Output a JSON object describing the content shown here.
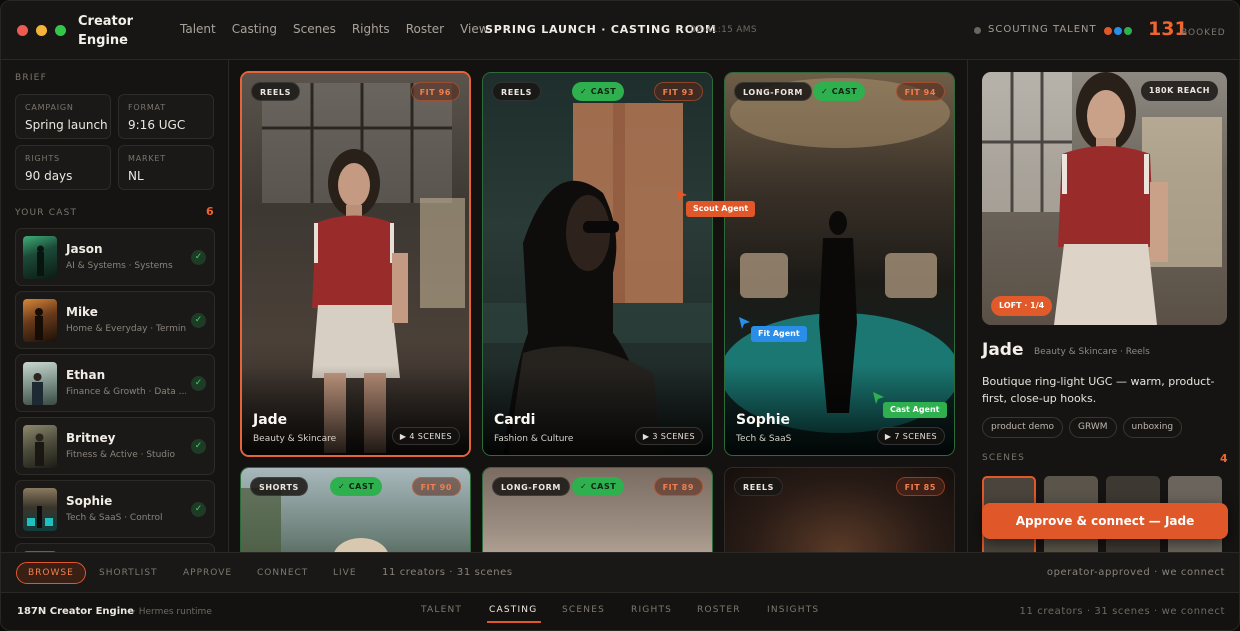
{
  "app": {
    "brand": "Creator Engine"
  },
  "nav": {
    "items": [
      "Talent",
      "Casting",
      "Scenes",
      "Rights",
      "Roster",
      "View"
    ]
  },
  "header": {
    "view_title": "SPRING LAUNCH · CASTING ROOM",
    "clock": "· 02:41:15 AMS",
    "status": "SCOUTING TALENT",
    "booked_count": "131",
    "booked_label": "BOOKED"
  },
  "brief": {
    "label": "BRIEF",
    "fields": [
      {
        "key": "CAMPAIGN",
        "value": "Spring launch"
      },
      {
        "key": "FORMAT",
        "value": "9:16 UGC"
      },
      {
        "key": "RIGHTS",
        "value": "90 days"
      },
      {
        "key": "MARKET",
        "value": "NL"
      }
    ]
  },
  "cast": {
    "label": "YOUR CAST",
    "count": "6",
    "items": [
      {
        "name": "Jason",
        "sub": "AI & Systems · Systems"
      },
      {
        "name": "Mike",
        "sub": "Home & Everyday · Terminal"
      },
      {
        "name": "Ethan",
        "sub": "Finance & Growth · Data ..."
      },
      {
        "name": "Britney",
        "sub": "Fitness & Active · Studio"
      },
      {
        "name": "Sophie",
        "sub": "Tech & SaaS · Control"
      }
    ]
  },
  "cards": [
    {
      "format": "REELS",
      "cast": "",
      "fit": "FIT 96",
      "name": "Jade",
      "category": "Beauty & Skincare",
      "scenes": "▶ 4 SCENES"
    },
    {
      "format": "REELS",
      "cast": "✓ CAST",
      "fit": "FIT 93",
      "name": "Cardi",
      "category": "Fashion & Culture",
      "scenes": "▶ 3 SCENES"
    },
    {
      "format": "LONG-FORM",
      "cast": "✓ CAST",
      "fit": "FIT 94",
      "name": "Sophie",
      "category": "Tech & SaaS",
      "scenes": "▶ 7 SCENES"
    },
    {
      "format": "SHORTS",
      "cast": "✓ CAST",
      "fit": "FIT 90"
    },
    {
      "format": "LONG-FORM",
      "cast": "✓ CAST",
      "fit": "FIT 89"
    },
    {
      "format": "REELS",
      "cast": "",
      "fit": "FIT 85"
    }
  ],
  "agents": {
    "scout": "Scout Agent",
    "fit": "Fit Agent",
    "cast": "Cast Agent"
  },
  "profile": {
    "reach": "180K REACH",
    "location": "LOFT · 1/4",
    "name": "Jade",
    "meta": "Beauty & Skincare · Reels",
    "description": "Boutique ring-light UGC — warm, product-first, close-up hooks.",
    "tags": [
      "product demo",
      "GRWM",
      "unboxing"
    ],
    "scenes_label": "SCENES",
    "scenes_count": "4",
    "approve_label": "Approve & connect — Jade"
  },
  "flow": {
    "active": "BROWSE",
    "steps": [
      "SHORTLIST",
      "APPROVE",
      "CONNECT",
      "LIVE"
    ],
    "summary": "11 creators · 31 scenes",
    "note": "operator-approved · we connect"
  },
  "footer": {
    "brand": "187N Creator Engine",
    "runtime": "· Hermes runtime",
    "tabs": [
      "TALENT",
      "CASTING",
      "SCENES",
      "RIGHTS",
      "ROSTER",
      "INSIGHTS"
    ],
    "active_tab": "CASTING",
    "note": "11 creators · 31 scenes · we connect"
  },
  "colors": {
    "accent": "#e0582a",
    "cast_green": "#2fb04f",
    "fit_agent": "#2a8ee8",
    "background": "#161412"
  }
}
